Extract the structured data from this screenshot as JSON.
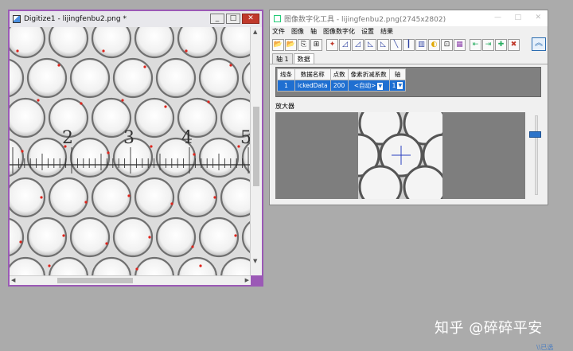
{
  "digitize_window": {
    "title": "Digitize1 - lijingfenbu2.png *",
    "minimize": "_",
    "maximize": "□",
    "close": "✕",
    "ruler_numbers": [
      "2",
      "3",
      "4",
      "5"
    ]
  },
  "tool_window": {
    "title": "图像数字化工具 - lijingfenbu2.png(2745x2802)",
    "menu": [
      "文件",
      "图像",
      "轴",
      "图像数字化",
      "设置",
      "结果"
    ],
    "toolbar_icons": [
      "open-icon",
      "open-folder-icon",
      "copy-icon",
      "crop-icon",
      "point-icon",
      "axis-icon",
      "slope-icon",
      "line-icon",
      "line-icon-2",
      "bar-icon",
      "bar-icon-2",
      "bars-icon",
      "color-icon",
      "export-icon",
      "grid-icon",
      "go-back-icon",
      "go-forward-icon",
      "add-icon",
      "delete-icon"
    ],
    "toolbar_glyphs": [
      "📂",
      "📂",
      "⎘",
      "⊞",
      "✦",
      "◿",
      "◿",
      "◺",
      "◺",
      "╲",
      "┃",
      "▥",
      "◐",
      "⊡",
      "▦",
      "⇤",
      "⇥",
      "✚",
      "✖"
    ],
    "collapse_label": "︽",
    "tabs": [
      "轴 1",
      "数据"
    ],
    "table": {
      "headers": [
        "线条",
        "数据名称",
        "点数",
        "像素折减系数",
        "轴"
      ],
      "rows": [
        [
          "1",
          "ickedData",
          "200",
          "<自动>",
          "1"
        ]
      ]
    },
    "magnifier_label": "放大器"
  },
  "watermark": "知乎 @碎碎平安",
  "corner_text": "\\\\已选"
}
